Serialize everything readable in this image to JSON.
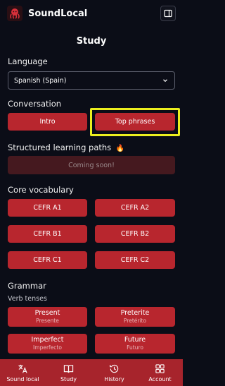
{
  "app": {
    "name": "SoundLocal",
    "logo_icon": "octopus-icon",
    "colors": {
      "accent": "#b8262e",
      "highlight": "#ecee1e",
      "background": "#0b0d17",
      "nav": "#a7242c"
    }
  },
  "page": {
    "title": "Study"
  },
  "language": {
    "label": "Language",
    "selected": "Spanish (Spain)"
  },
  "conversation": {
    "label": "Conversation",
    "buttons": [
      "Intro",
      "Top phrases"
    ]
  },
  "structured": {
    "label": "Structured learning paths",
    "emoji": "🔥",
    "coming_soon": "Coming soon!"
  },
  "core_vocabulary": {
    "label": "Core vocabulary",
    "levels": [
      "CEFR A1",
      "CEFR A2",
      "CEFR B1",
      "CEFR B2",
      "CEFR C1",
      "CEFR C2"
    ]
  },
  "grammar": {
    "label": "Grammar",
    "verb_tenses_label": "Verb tenses",
    "tenses": [
      {
        "name": "Present",
        "spanish": "Presente"
      },
      {
        "name": "Preterite",
        "spanish": "Pretérito"
      },
      {
        "name": "Imperfect",
        "spanish": "Imperfecto"
      },
      {
        "name": "Future",
        "spanish": "Futuro"
      }
    ]
  },
  "bottom_nav": {
    "items": [
      {
        "label": "Sound local",
        "icon": "translate-icon"
      },
      {
        "label": "Study",
        "icon": "book-icon"
      },
      {
        "label": "History",
        "icon": "history-icon"
      },
      {
        "label": "Account",
        "icon": "grid-icon"
      }
    ],
    "active": "Study"
  }
}
